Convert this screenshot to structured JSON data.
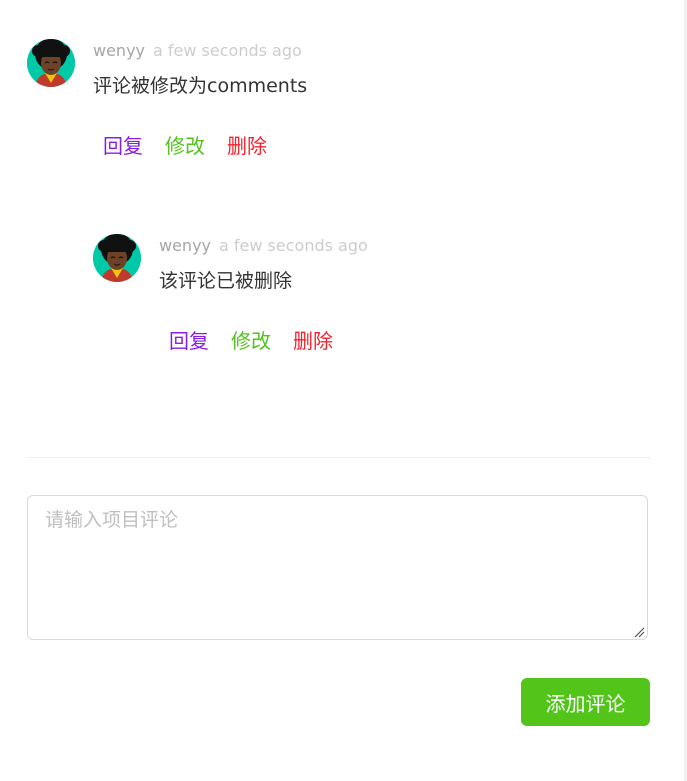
{
  "comments": [
    {
      "author": "wenyy",
      "time": "a few seconds ago",
      "content": "评论被修改为comments",
      "actions": {
        "reply": "回复",
        "edit": "修改",
        "delete": "删除"
      }
    },
    {
      "author": "wenyy",
      "time": "a few seconds ago",
      "content": "该评论已被删除",
      "actions": {
        "reply": "回复",
        "edit": "修改",
        "delete": "删除"
      }
    }
  ],
  "editor": {
    "placeholder": "请输入项目评论",
    "value": ""
  },
  "submit_label": "添加评论",
  "colors": {
    "reply": "#8b1de0",
    "edit": "#52c41a",
    "delete": "#f5222d",
    "primary": "#52c41a",
    "avatar_bg": "#00c9a7"
  }
}
